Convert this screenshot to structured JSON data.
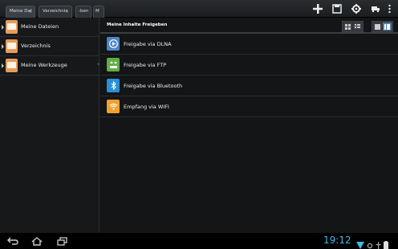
{
  "tabs": [
    {
      "label": "Meine Dat",
      "close": "✕",
      "active": true
    },
    {
      "label": "Verzeichnis",
      "close": "✕",
      "active": false
    },
    {
      "label": "-ben",
      "close": "",
      "active": false
    },
    {
      "label": "M",
      "close": "✕",
      "active": false
    }
  ],
  "actions": [
    "add-icon",
    "sdcard-icon",
    "settings-icon",
    "truck-icon",
    "overflow-menu-icon"
  ],
  "left": {
    "items": [
      {
        "label": "Meine Dateien",
        "icon": "folder-icon"
      },
      {
        "label": "Verzeichnis",
        "icon": "folder-icon"
      },
      {
        "label": "Meine Werkzeuge",
        "icon": "folder-icon"
      }
    ]
  },
  "right": {
    "title": "Meine Inhalte Freigeben",
    "items": [
      {
        "label": "Freigabe via DLNA",
        "icon": "dlna-play-icon",
        "color": "#4a86c8"
      },
      {
        "label": "Freigabe via FTP",
        "icon": "ftp-icon",
        "color": "#5fae45"
      },
      {
        "label": "Freigabe via Bluetooth",
        "icon": "bluetooth-icon",
        "color": "#2c8fd6"
      },
      {
        "label": "Empfang via WIFI",
        "icon": "wifi-icon",
        "color": "#f0a030"
      }
    ]
  },
  "status": {
    "time": "19:12",
    "accent": "#44b8e6"
  }
}
